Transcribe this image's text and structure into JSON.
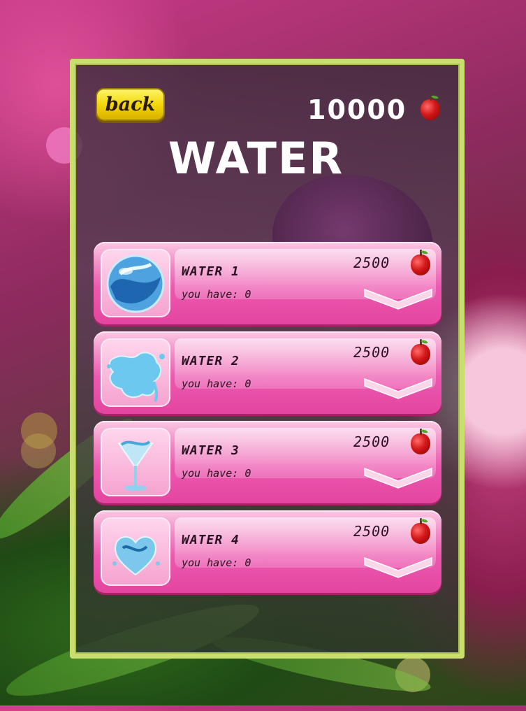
{
  "header": {
    "back_label": "back",
    "coins": "10000",
    "title": "WATER"
  },
  "items": [
    {
      "name": "WATER 1",
      "have_label": "you have:",
      "have_count": "0",
      "price": "2500",
      "icon": "water-globe-icon"
    },
    {
      "name": "WATER 2",
      "have_label": "you have:",
      "have_count": "0",
      "price": "2500",
      "icon": "water-splash-icon"
    },
    {
      "name": "WATER 3",
      "have_label": "you have:",
      "have_count": "0",
      "price": "2500",
      "icon": "water-glass-icon"
    },
    {
      "name": "WATER 4",
      "have_label": "you have:",
      "have_count": "0",
      "price": "2500",
      "icon": "water-heart-icon"
    }
  ],
  "colors": {
    "frame": "#c9de6e",
    "card": "#ec5ab0",
    "back_button": "#f1d400",
    "currency": "#d21818"
  },
  "currency_icon": "apple-icon"
}
